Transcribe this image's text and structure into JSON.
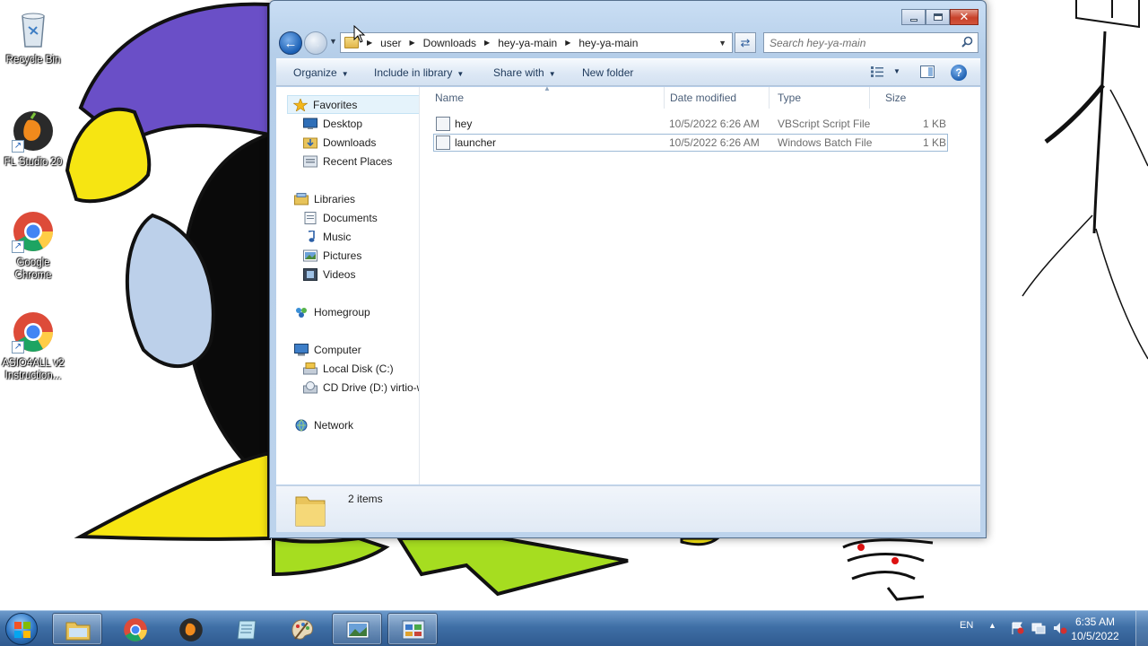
{
  "desktop": {
    "icons": [
      {
        "label": "Recycle Bin"
      },
      {
        "label": "FL Studio 20"
      },
      {
        "label": "Google Chrome"
      },
      {
        "label": "ASIO4ALL v2 Instruction..."
      }
    ]
  },
  "window": {
    "breadcrumbs": [
      "user",
      "Downloads",
      "hey-ya-main",
      "hey-ya-main"
    ],
    "search_placeholder": "Search hey-ya-main",
    "toolbar": {
      "organize": "Organize",
      "include_in_library": "Include in library",
      "share_with": "Share with",
      "new_folder": "New folder"
    },
    "nav": {
      "favorites": "Favorites",
      "desktop": "Desktop",
      "downloads": "Downloads",
      "recent_places": "Recent Places",
      "libraries": "Libraries",
      "documents": "Documents",
      "music": "Music",
      "pictures": "Pictures",
      "videos": "Videos",
      "homegroup": "Homegroup",
      "computer": "Computer",
      "local_disk": "Local Disk (C:)",
      "cd_drive": "CD Drive (D:) virtio-win",
      "network": "Network"
    },
    "columns": {
      "name": "Name",
      "date_modified": "Date modified",
      "type": "Type",
      "size": "Size"
    },
    "files": [
      {
        "name": "hey",
        "date": "10/5/2022 6:26 AM",
        "type": "VBScript Script File",
        "size": "1 KB"
      },
      {
        "name": "launcher",
        "date": "10/5/2022 6:26 AM",
        "type": "Windows Batch File",
        "size": "1 KB"
      }
    ],
    "status": "2 items"
  },
  "taskbar": {
    "language": "EN",
    "time": "6:35 AM",
    "date": "10/5/2022"
  }
}
